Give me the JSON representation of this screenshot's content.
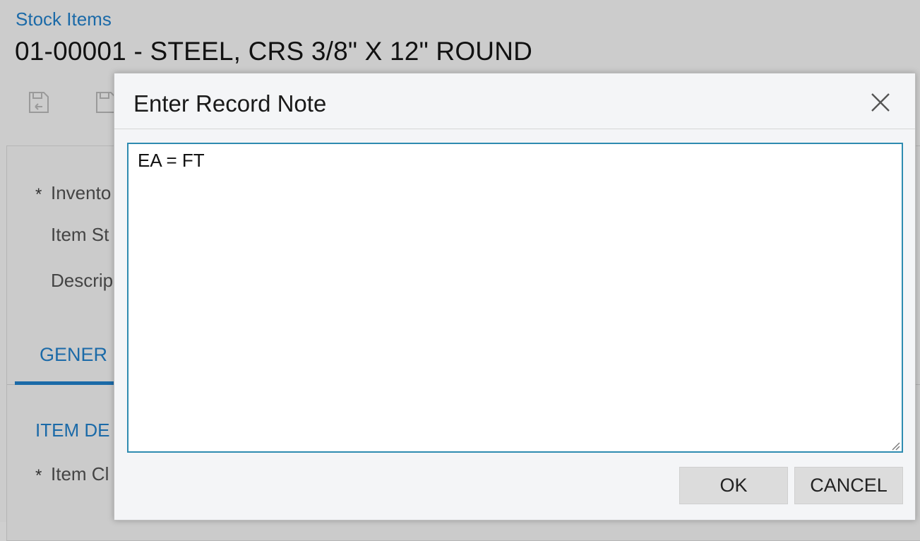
{
  "page": {
    "breadcrumb": "Stock Items",
    "title": "01-00001 - STEEL, CRS 3/8\" X 12\" ROUND",
    "fields": {
      "inventory_label": "Invento",
      "item_status_label": "Item St",
      "description_label": "Descrip",
      "item_class_label": "Item Cl"
    },
    "tab_general": "GENER",
    "section_item_defaults": "ITEM DE",
    "required_mark": "*"
  },
  "dialog": {
    "title": "Enter Record Note",
    "note_value": "EA = FT",
    "ok_label": "OK",
    "cancel_label": "CANCEL"
  },
  "colors": {
    "accent": "#1b6aa8",
    "focus_border": "#2e8bb0",
    "overlay": "#cccccc"
  }
}
